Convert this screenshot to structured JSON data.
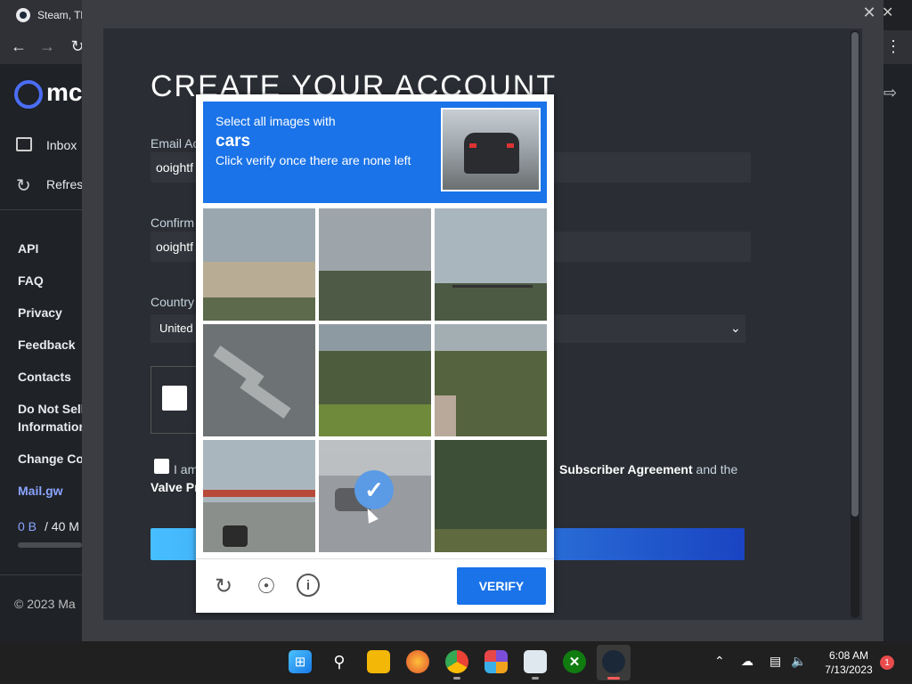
{
  "browser": {
    "tab_title": "Steam, Th"
  },
  "sidebar": {
    "logo_text": "mc",
    "items": [
      {
        "label": "Inbox"
      },
      {
        "label": "Refres"
      }
    ],
    "links": [
      {
        "label": "API"
      },
      {
        "label": "FAQ"
      },
      {
        "label": "Privacy"
      },
      {
        "label": "Feedback"
      },
      {
        "label": "Contacts"
      },
      {
        "label": "Do Not Sell"
      },
      {
        "label": "Information"
      },
      {
        "label": "Change Co"
      },
      {
        "label": "Mail.gw"
      }
    ],
    "storage_used": "0 B",
    "storage_total": "/ 40 M",
    "copyright": "© 2023 Ma"
  },
  "steam": {
    "title": "CREATE YOUR ACCOUNT",
    "email_label": "Email Ac",
    "email_value": "ooightf",
    "confirm_label": "Confirm",
    "confirm_value": "ooightf",
    "country_label": "Country",
    "country_value": "United",
    "agree_text": "I am",
    "agree_link": "Subscriber Agreement",
    "agree_and": "and the",
    "valve_text": "Valve Pr"
  },
  "recaptcha": {
    "line1": "Select all images with",
    "keyword": "cars",
    "line3": "Click verify once there are none left",
    "verify_label": "VERIFY",
    "selected_tile": 8
  },
  "taskbar": {
    "time": "6:08 AM",
    "date": "7/13/2023",
    "notification_count": "1"
  }
}
